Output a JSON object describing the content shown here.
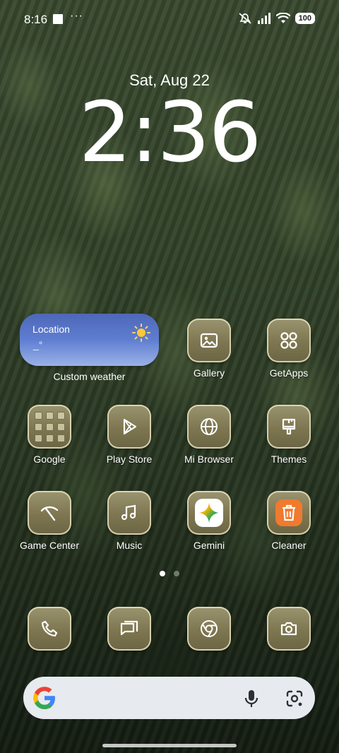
{
  "status_bar": {
    "time": "8:16",
    "dots": "···",
    "battery": "100"
  },
  "lockscreen": {
    "date": "Sat, Aug 22",
    "clock": "2:36"
  },
  "weather_widget": {
    "location": "Location",
    "temperature": "_°",
    "label": "Custom weather"
  },
  "apps": [
    {
      "label": "Gallery",
      "icon": "gallery-icon"
    },
    {
      "label": "GetApps",
      "icon": "getapps-icon"
    },
    {
      "label": "Google",
      "icon": "google-folder-icon"
    },
    {
      "label": "Play Store",
      "icon": "play-store-icon"
    },
    {
      "label": "Mi Browser",
      "icon": "globe-icon"
    },
    {
      "label": "Themes",
      "icon": "paintbrush-icon"
    },
    {
      "label": "Game Center",
      "icon": "game-center-icon"
    },
    {
      "label": "Music",
      "icon": "music-note-icon"
    },
    {
      "label": "Gemini",
      "icon": "gemini-icon"
    },
    {
      "label": "Cleaner",
      "icon": "trash-icon"
    }
  ],
  "dock": [
    "phone-icon",
    "messages-icon",
    "chrome-icon",
    "camera-icon"
  ],
  "pager": {
    "pages": 2,
    "active": 1
  },
  "colors": {
    "icon_tint": "#7d7650",
    "weather_blue": "#5f7ed1",
    "cleaner_orange": "#f07a2e",
    "search_bg": "#e7eaee"
  }
}
